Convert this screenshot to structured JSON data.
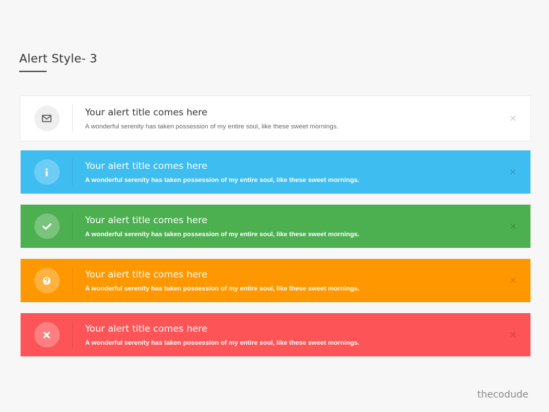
{
  "page": {
    "title": "Alert Style- 3",
    "watermark": "thecodude"
  },
  "alerts": [
    {
      "variant": "default",
      "icon": "envelope-icon",
      "color": "#ffffff",
      "title": "Your alert title comes here",
      "text": "A wonderful serenity has taken possession of my entire soul, like these sweet mornings.",
      "close": "✕"
    },
    {
      "variant": "info",
      "icon": "info-icon",
      "color": "#3ebdf0",
      "title": "Your alert title comes here",
      "text": "A wonderful serenity has taken possession of my entire soul, like these sweet mornings.",
      "close": "✕"
    },
    {
      "variant": "success",
      "icon": "check-icon",
      "color": "#4caf50",
      "title": "Your alert title comes here",
      "text": "A wonderful serenity has taken possession of my entire soul, like these sweet mornings.",
      "close": "✕"
    },
    {
      "variant": "warning",
      "icon": "question-icon",
      "color": "#ff9800",
      "title": "Your alert title comes here",
      "text": "A wonderful serenity has taken possession of my entire soul, like these sweet mornings.",
      "close": "✕"
    },
    {
      "variant": "danger",
      "icon": "times-icon",
      "color": "#fd5457",
      "title": "Your alert title comes here",
      "text": "A wonderful serenity has taken possession of my entire soul, like these sweet mornings.",
      "close": "✕"
    }
  ]
}
